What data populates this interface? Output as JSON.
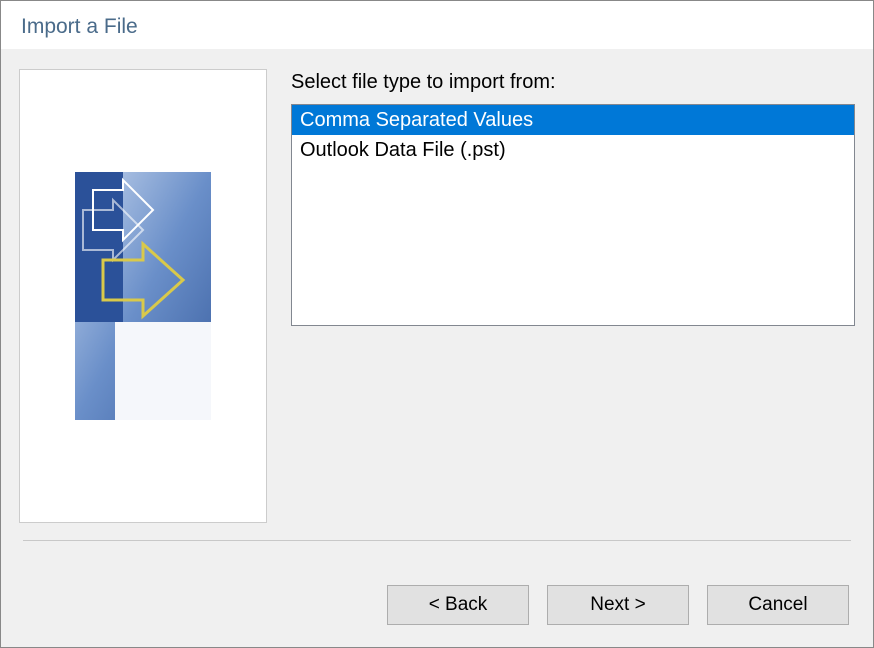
{
  "dialog": {
    "title": "Import a File"
  },
  "main": {
    "list_label": "Select file type to import from:",
    "file_types": [
      {
        "label": "Comma Separated Values",
        "selected": true
      },
      {
        "label": "Outlook Data File (.pst)",
        "selected": false
      }
    ]
  },
  "buttons": {
    "back": "< Back",
    "next": "Next >",
    "cancel": "Cancel"
  }
}
